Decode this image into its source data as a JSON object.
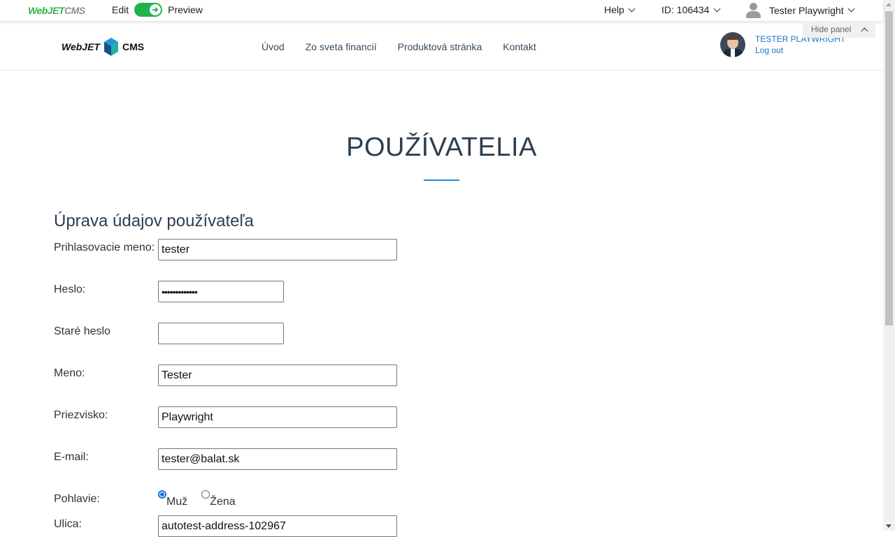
{
  "admin_bar": {
    "logo_web": "WebJET",
    "logo_cms": "CMS",
    "edit_label": "Edit",
    "preview_label": "Preview",
    "help_label": "Help",
    "page_id": "ID: 106434",
    "user_name": "Tester Playwright",
    "hide_panel": "Hide panel"
  },
  "site_header": {
    "logo_left": "WebJET",
    "logo_right": "CMS",
    "nav": [
      "Úvod",
      "Zo sveta financií",
      "Produktová stránka",
      "Kontakt"
    ],
    "profile_name": "TESTER PLAYWRIGHT",
    "logout": "Log out"
  },
  "page": {
    "title": "POUŽÍVATELIA",
    "form_heading": "Úprava údajov používateľa",
    "fields": {
      "login_label": "Prihlasovacie meno:",
      "login_value": "tester",
      "password_label": "Heslo:",
      "password_value": "•••••••••••••",
      "old_password_label": "Staré heslo",
      "old_password_value": "",
      "first_name_label": "Meno:",
      "first_name_value": "Tester",
      "last_name_label": "Priezvisko:",
      "last_name_value": "Playwright",
      "email_label": "E-mail:",
      "email_value": "tester@balat.sk",
      "gender_label": "Pohlavie:",
      "gender_options": [
        "Muž",
        "Žena"
      ],
      "gender_selected": "Muž",
      "street_label": "Ulica:",
      "street_value": "autotest-address-102967"
    }
  },
  "colors": {
    "accent_green": "#22b14c",
    "link_blue": "#1e73be",
    "title_line": "#1e90d6",
    "heading": "#2c3e50"
  }
}
